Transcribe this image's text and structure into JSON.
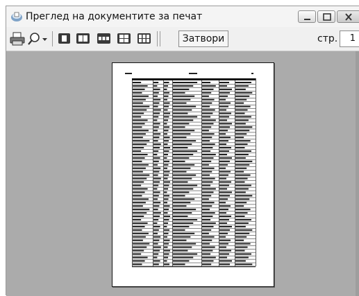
{
  "window": {
    "title": "Преглед на документите за печат"
  },
  "toolbar": {
    "print_icon": "printer-icon",
    "zoom_icon": "magnifier-icon",
    "one_page_icon": "one-page-icon",
    "two_pages_icon": "two-pages-icon",
    "three_pages_icon": "three-pages-icon",
    "four_pages_icon": "four-pages-icon",
    "six_pages_icon": "six-pages-icon",
    "close_label": "Затвори",
    "page_label": "стр.",
    "page_value": "1"
  }
}
